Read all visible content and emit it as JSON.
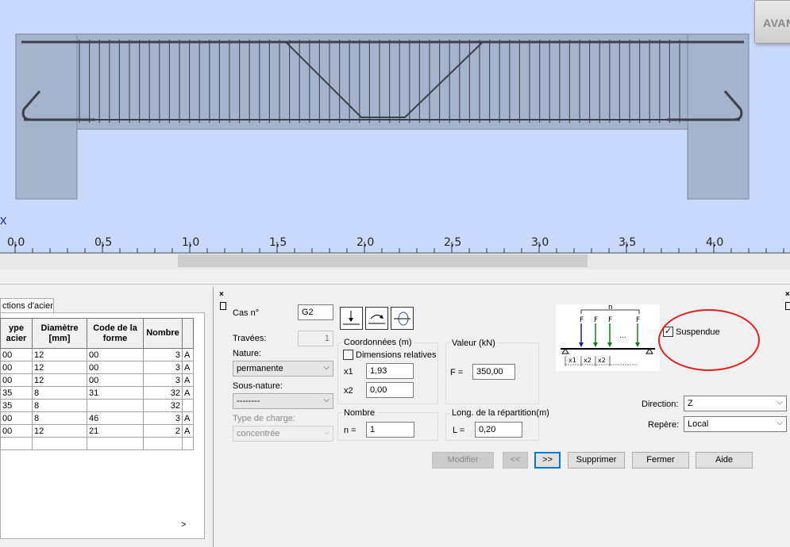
{
  "canvas": {
    "avant_label": "AVAN",
    "axis_label": "x",
    "ticks": [
      "0,0",
      "0,5",
      "1,0",
      "1,5",
      "2,0",
      "2,5",
      "3,0",
      "3,5",
      "4,0"
    ]
  },
  "steel_table": {
    "tab_label": "ctions d'acier",
    "columns": [
      "ype\nacier",
      "Diamètre\n[mm]",
      "Code de la\nforme",
      "Nombre",
      ""
    ],
    "rows": [
      [
        "00",
        "12",
        "00",
        "3",
        "A"
      ],
      [
        "00",
        "12",
        "00",
        "3",
        "A"
      ],
      [
        "00",
        "12",
        "00",
        "3",
        "A"
      ],
      [
        "35",
        "8",
        "31",
        "32",
        "A"
      ],
      [
        "35",
        "8",
        "",
        "32",
        ""
      ],
      [
        "00",
        "8",
        "46",
        "3",
        "A"
      ],
      [
        "00",
        "12",
        "21",
        "2",
        "A"
      ],
      [
        "",
        "",
        "",
        "",
        ""
      ]
    ]
  },
  "form": {
    "cas_label": "Cas n°",
    "cas_value": "G2",
    "travees_label": "Travées:",
    "travees_value": "1",
    "nature_label": "Nature:",
    "nature_value": "permanente",
    "sous_nature_label": "Sous-nature:",
    "sous_nature_value": "--------",
    "type_charge_label": "Type de charge:",
    "type_charge_value": "concentrée",
    "coordonnees_title": "Coordonnées (m)",
    "dimensions_relatives_label": "Dimensions relatives",
    "x1_label": "x1",
    "x1_value": "1,93",
    "x2_label": "x2",
    "x2_value": "0,00",
    "valeur_title": "Valeur (kN)",
    "f_label": "F =",
    "f_value": "350,00",
    "nombre_title": "Nombre",
    "n_label": "n =",
    "n_value": "1",
    "long_title": "Long. de la répartition(m)",
    "l_label": "L =",
    "l_value": "0,20",
    "suspendue_label": "Suspendue",
    "suspendue_checked": "✓",
    "direction_label": "Direction:",
    "direction_value": "Z",
    "repere_label": "Repère:",
    "repere_value": "Local",
    "diagram": {
      "n": "n",
      "f": "F",
      "dots": "...",
      "x1": "x1",
      "x2": "x2"
    }
  },
  "buttons": {
    "modifier": "Modifier",
    "prev": "<<",
    "next": ">>",
    "supprimer": "Supprimer",
    "fermer": "Fermer",
    "aide": "Aide"
  },
  "colors": {
    "canvas_bg": "#c8d9fb",
    "annotation": "#e02020",
    "focus": "#0078d7"
  }
}
